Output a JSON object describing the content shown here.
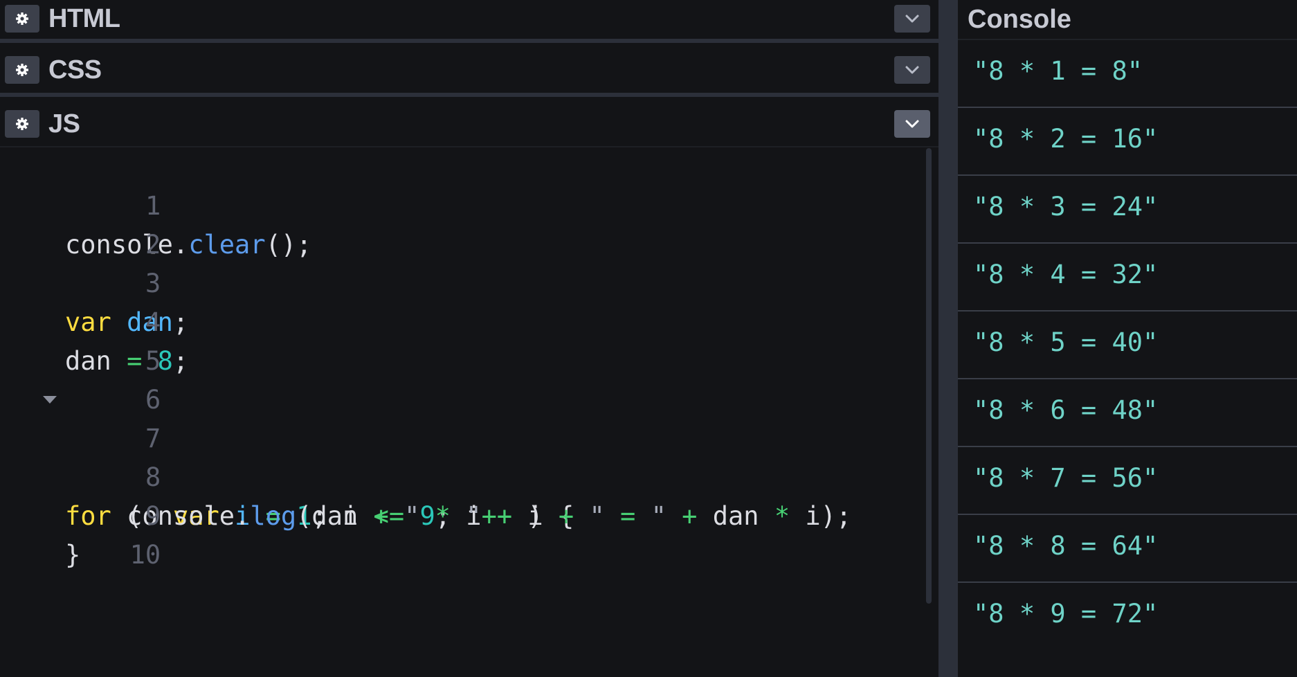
{
  "panels": {
    "html": {
      "title": "HTML"
    },
    "css": {
      "title": "CSS"
    },
    "js": {
      "title": "JS"
    }
  },
  "editor": {
    "line_numbers": [
      "1",
      "2",
      "3",
      "4",
      "5",
      "6",
      "7",
      "8",
      "9",
      "10"
    ],
    "tokens": {
      "l1_console": "console",
      "l1_dot": ".",
      "l1_clear": "clear",
      "l1_rest": "();",
      "l3_var": "var",
      "l3_dan": "dan",
      "l3_semi": ";",
      "l4_dan": "dan",
      "l4_eq": "=",
      "l4_num": "8",
      "l4_semi": ";",
      "l7_for": "for",
      "l7_paren": "(",
      "l7_var": "var",
      "l7_i": "i",
      "l7_eq": "=",
      "l7_one": "1",
      "l7_semi1": ";",
      "l7_i2": "i",
      "l7_le": "<=",
      "l7_nine": "9",
      "l7_semi2": ";",
      "l7_i3": "i",
      "l7_pp": "++",
      "l7_close": ") {",
      "l8_console": "console",
      "l8_dot": ".",
      "l8_log": "log",
      "l8_open": "(dan",
      "l8_plus1": "+",
      "l8_q1": "\"",
      "l8_star": "*",
      "l8_q2": "\"",
      "l8_plus2": "+",
      "l8_i": "i",
      "l8_plus3": "+",
      "l8_q3": "\"",
      "l8_eq": "=",
      "l8_q4": "\"",
      "l8_plus4": "+",
      "l8_dan": "dan",
      "l8_star2": "*",
      "l8_end": "i);",
      "l9_brace": "}"
    }
  },
  "console": {
    "title": "Console",
    "entries": [
      "\"8 * 1 = 8\"",
      "\"8 * 2 = 16\"",
      "\"8 * 3 = 24\"",
      "\"8 * 4 = 32\"",
      "\"8 * 5 = 40\"",
      "\"8 * 6 = 48\"",
      "\"8 * 7 = 56\"",
      "\"8 * 8 = 64\"",
      "\"8 * 9 = 72\""
    ]
  },
  "icons": {
    "settings": "gear-icon",
    "collapse": "chevron-down-icon"
  },
  "colors": {
    "background": "#131417",
    "keyword": "#ffdd40",
    "variable": "#53b8ff",
    "function": "#5d9cec",
    "operator": "#47cf73",
    "number": "#2bc7b9",
    "console_text": "#6fd3c8"
  }
}
